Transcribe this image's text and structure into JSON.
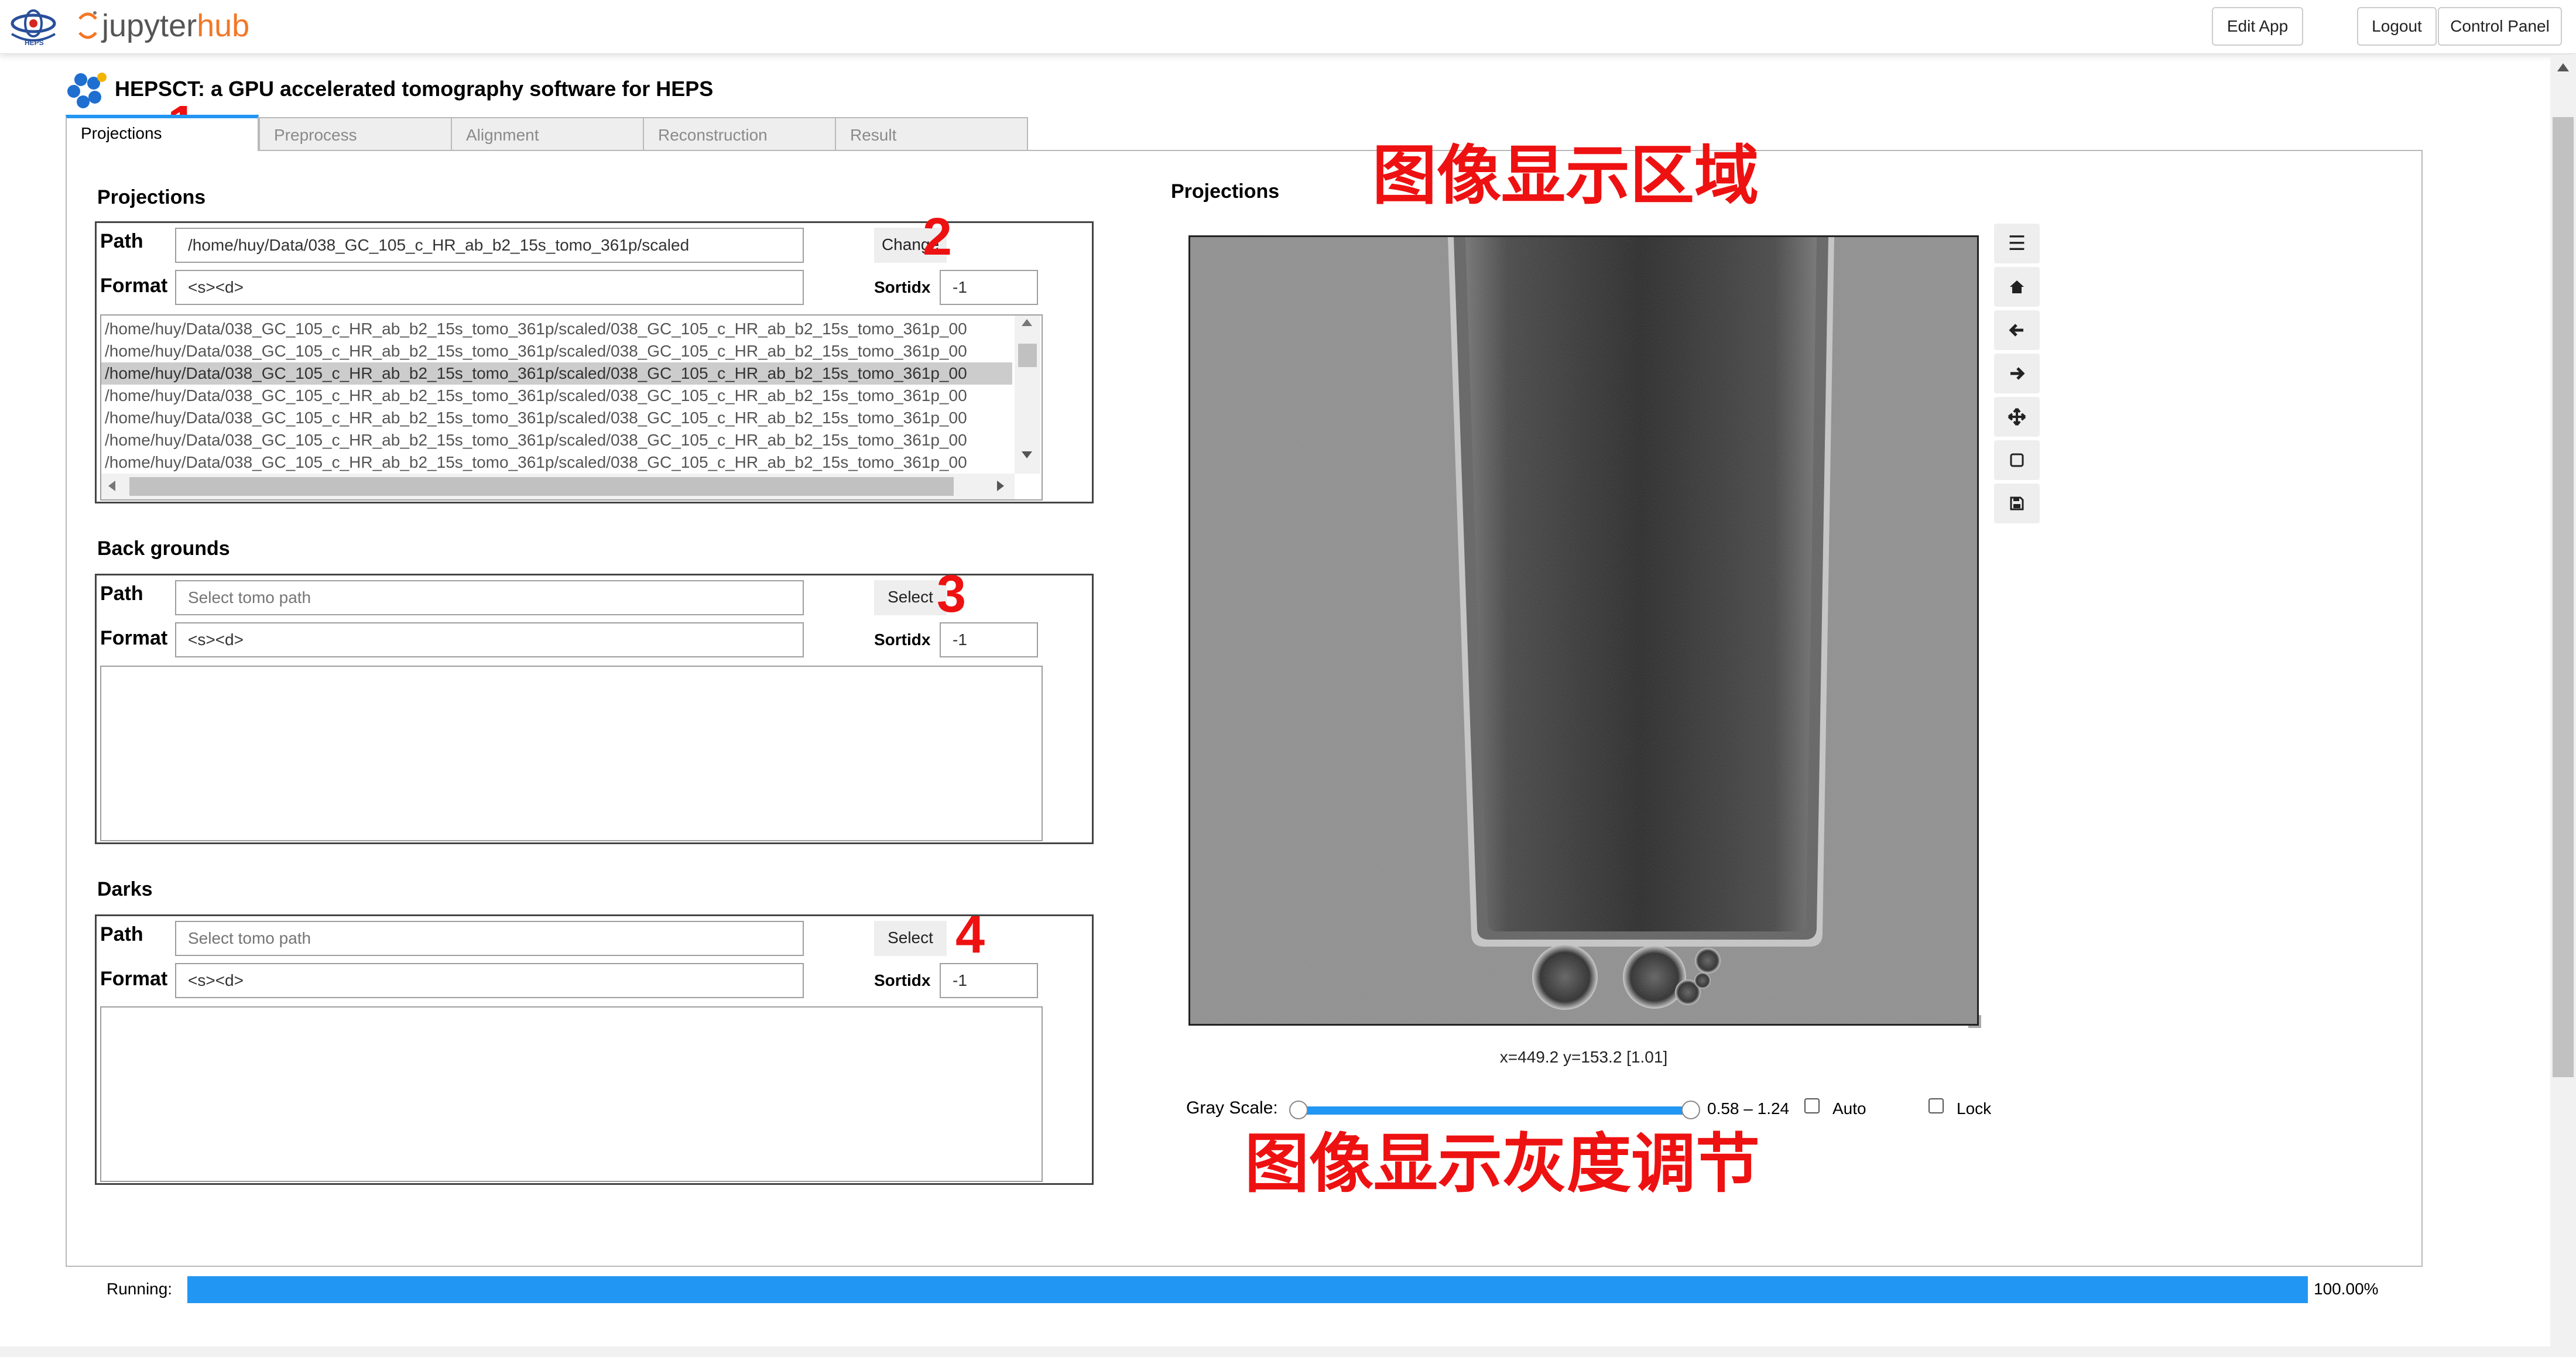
{
  "header": {
    "heps_logo_text": "HEPS",
    "hub_prefix": "jupyter",
    "hub_suffix": "hub",
    "edit_app": "Edit App",
    "logout": "Logout",
    "control_panel": "Control Panel"
  },
  "app": {
    "title": "HEPSCT: a GPU accelerated tomography software for HEPS"
  },
  "tabs": [
    {
      "label": "Projections",
      "active": true
    },
    {
      "label": "Preprocess"
    },
    {
      "label": "Alignment"
    },
    {
      "label": "Reconstruction"
    },
    {
      "label": "Result"
    }
  ],
  "projections": {
    "title": "Projections",
    "path_label": "Path",
    "path_value": "/home/huy/Data/038_GC_105_c_HR_ab_b2_15s_tomo_361p/scaled",
    "change_btn": "Change",
    "format_label": "Format",
    "format_value": "<s><d>",
    "sortidx_label": "Sortidx",
    "sortidx_value": "-1",
    "files": [
      "/home/huy/Data/038_GC_105_c_HR_ab_b2_15s_tomo_361p/scaled/038_GC_105_c_HR_ab_b2_15s_tomo_361p_00",
      "/home/huy/Data/038_GC_105_c_HR_ab_b2_15s_tomo_361p/scaled/038_GC_105_c_HR_ab_b2_15s_tomo_361p_00",
      "/home/huy/Data/038_GC_105_c_HR_ab_b2_15s_tomo_361p/scaled/038_GC_105_c_HR_ab_b2_15s_tomo_361p_00",
      "/home/huy/Data/038_GC_105_c_HR_ab_b2_15s_tomo_361p/scaled/038_GC_105_c_HR_ab_b2_15s_tomo_361p_00",
      "/home/huy/Data/038_GC_105_c_HR_ab_b2_15s_tomo_361p/scaled/038_GC_105_c_HR_ab_b2_15s_tomo_361p_00",
      "/home/huy/Data/038_GC_105_c_HR_ab_b2_15s_tomo_361p/scaled/038_GC_105_c_HR_ab_b2_15s_tomo_361p_00",
      "/home/huy/Data/038_GC_105_c_HR_ab_b2_15s_tomo_361p/scaled/038_GC_105_c_HR_ab_b2_15s_tomo_361p_00"
    ],
    "selected_file_index": 2
  },
  "backgrounds": {
    "title": "Back grounds",
    "path_label": "Path",
    "path_placeholder": "Select tomo path",
    "select_btn": "Select",
    "format_label": "Format",
    "format_value": "<s><d>",
    "sortidx_label": "Sortidx",
    "sortidx_value": "-1"
  },
  "darks": {
    "title": "Darks",
    "path_label": "Path",
    "path_placeholder": "Select tomo path",
    "select_btn": "Select",
    "format_label": "Format",
    "format_value": "<s><d>",
    "sortidx_label": "Sortidx",
    "sortidx_value": "-1"
  },
  "viewer": {
    "title": "Projections",
    "coords": "x=449.2 y=153.2 [1.01]",
    "gray_scale_label": "Gray Scale:",
    "gray_range": "0.58 – 1.24",
    "gray_min_fraction": 0.0,
    "gray_max_fraction": 1.0,
    "auto_label": "Auto",
    "lock_label": "Lock",
    "toolbar_icons": [
      "menu-icon",
      "home-icon",
      "back-arrow-icon",
      "forward-arrow-icon",
      "move-icon",
      "zoom-rect-icon",
      "save-icon"
    ]
  },
  "annotations": {
    "mark1": "1",
    "mark2": "2",
    "mark3": "3",
    "mark4": "4",
    "display_area": "图像显示区域",
    "gray_adjust": "图像显示灰度调节"
  },
  "status": {
    "running_label": "Running:",
    "progress_percent": 100,
    "progress_text": "100.00%"
  },
  "colors": {
    "accent": "#2196f3",
    "hub_orange": "#f37726",
    "annotation_red": "#ee1111"
  }
}
